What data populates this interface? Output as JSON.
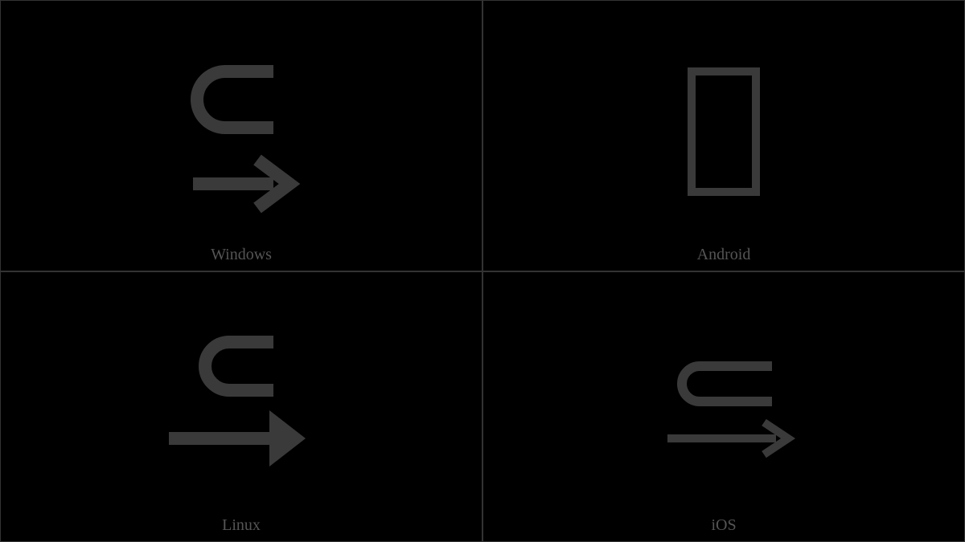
{
  "cells": [
    {
      "label": "Windows"
    },
    {
      "label": "Android"
    },
    {
      "label": "Linux"
    },
    {
      "label": "iOS"
    }
  ],
  "glyph": {
    "codepoint_name": "subset-above-rightwards-arrow"
  }
}
